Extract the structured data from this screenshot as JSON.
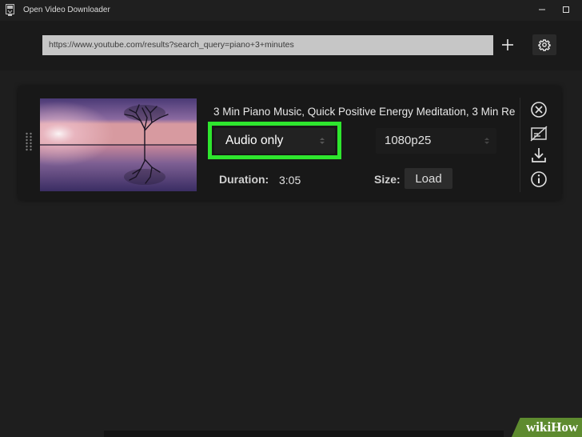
{
  "window": {
    "title": "Open Video Downloader"
  },
  "toolbar": {
    "url_value": "https://www.youtube.com/results?search_query=piano+3+minutes"
  },
  "video": {
    "title": "3 Min Piano Music, Quick Positive Energy Meditation, 3 Min Re",
    "format_selected": "Audio only",
    "resolution_selected": "1080p25",
    "duration_label": "Duration:",
    "duration_value": "3:05",
    "size_label": "Size:",
    "load_label": "Load"
  },
  "icons": [
    "app-icon",
    "minimize-icon",
    "maximize-icon",
    "plus-icon",
    "gear-icon",
    "drag-handle-icon",
    "remove-icon",
    "no-subtitles-icon",
    "download-icon",
    "info-icon"
  ],
  "colors": {
    "highlight": "#2ee62e",
    "background": "#1d1d1d",
    "watermark": "#5e8b2f"
  },
  "watermark": {
    "part1": "wiki",
    "part2": "How"
  }
}
